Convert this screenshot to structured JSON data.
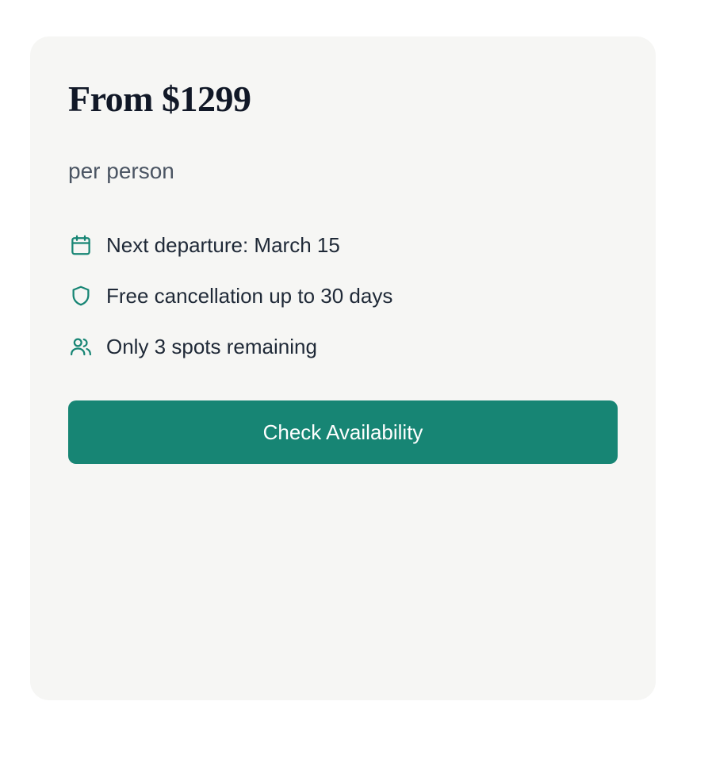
{
  "card": {
    "price_label": "From $1299",
    "per_person": "per person",
    "features": [
      {
        "icon": "calendar-icon",
        "text": "Next departure: March 15"
      },
      {
        "icon": "shield-icon",
        "text": "Free cancellation up to 30 days"
      },
      {
        "icon": "users-icon",
        "text": "Only 3 spots remaining"
      }
    ],
    "cta_label": "Check Availability"
  },
  "colors": {
    "accent": "#178574",
    "card_bg": "#f6f6f4",
    "heading": "#111827",
    "muted": "#4b5563"
  }
}
